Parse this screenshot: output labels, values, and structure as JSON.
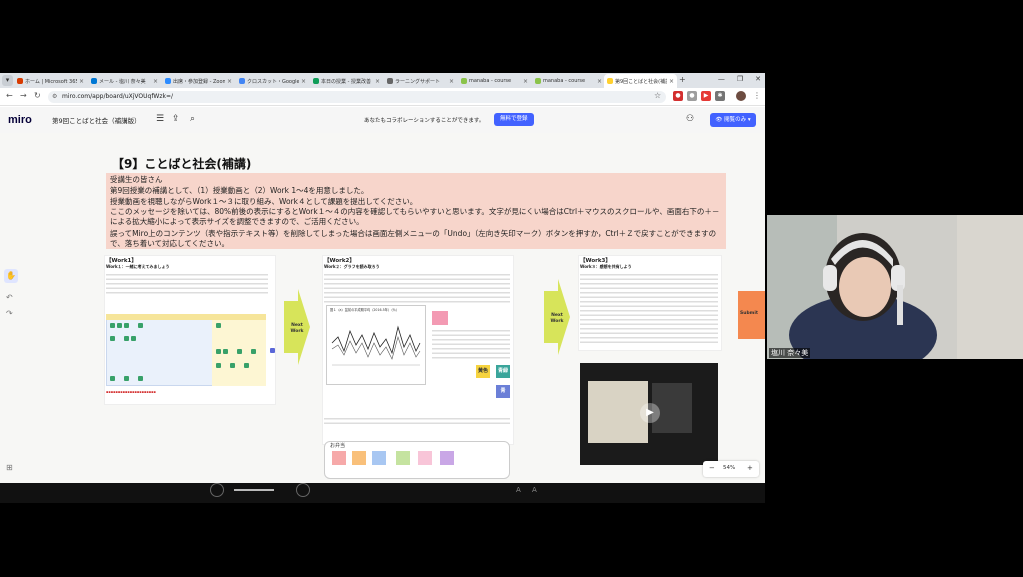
{
  "browser": {
    "tabs": [
      {
        "label": "ホーム | Microsoft 365",
        "color": "#d83b01"
      },
      {
        "label": "メール - 塩川 奈々美",
        "color": "#0078d4"
      },
      {
        "label": "出席・参加登録 - Zoom",
        "color": "#2d8cff"
      },
      {
        "label": "クロスカット・Google",
        "color": "#4285f4"
      },
      {
        "label": "本日の授業 - 授業改善",
        "color": "#0f9d58"
      },
      {
        "label": "ラーニングサポート",
        "color": "#666666"
      },
      {
        "label": "manaba - course",
        "color": "#8bc34a"
      },
      {
        "label": "manaba - course",
        "color": "#8bc34a"
      },
      {
        "label": "第9回ことばと社会(補講)",
        "color": "#ffd02f"
      }
    ],
    "url": "miro.com/app/board/uXjVOUqfWzk=/"
  },
  "miro": {
    "logo": "miro",
    "board_title": "第9回ことばと社会（補講版）",
    "collab_msg": "あなたもコラボレーションすることができます。",
    "free_btn": "無料で登録",
    "view_btn": "閲覧のみ",
    "zoom_level": "54%"
  },
  "board": {
    "heading": "【9】ことばと社会(補講)",
    "notice_lines": [
      "受講生の皆さん",
      "第9回授業の補講として、（1）授業動画と（2）Work 1～4を用意しました。",
      "授業動画を視聴しながらWork１～３に取り組み、Work４として課題を提出してください。",
      "ここのメッセージを除いては、80%前後の表示にするとWork１～４の内容を確認してもらいやすいと思います。文字が見にくい場合はCtrl＋マウスのスクロールや、画面右下の＋－による拡大縮小によって表示サイズを調整できますので、ご活用ください。",
      "誤ってMiro上のコンテンツ（表や指示テキスト等）を削除してしまった場合は画面左側メニューの「Undo」（左向き矢印マーク）ボタンを押すか，Ctrl＋Ｚで戻すことができますので、落ち着いて対応してください。"
    ],
    "work1": {
      "title": "【Work1】",
      "subtitle": "Work１：一緒に考えてみましょう"
    },
    "work2": {
      "title": "【Work2】",
      "subtitle": "Work２：グラフを読み取ろう",
      "chart_title": "図１（a）盆前の平成期平均（2016-5年）（％）"
    },
    "work3": {
      "title": "【Work3】",
      "subtitle": "Work３：感想を共有しよう"
    },
    "next_work": "Next Work",
    "submit": "Submit",
    "stickies": [
      "黄色",
      "青緑",
      "青"
    ],
    "otayori": "お弁当"
  },
  "webcam": {
    "name": "塩川 奈々美"
  }
}
